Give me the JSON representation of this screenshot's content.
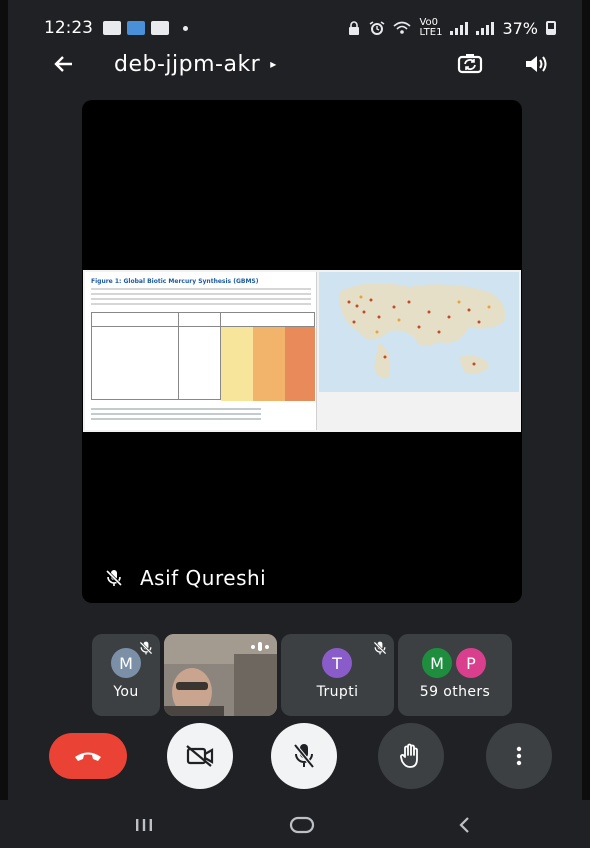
{
  "status_bar": {
    "time": "12:23",
    "battery": "37%",
    "network_label_top": "Vo0",
    "network_label_bottom": "LTE1"
  },
  "header": {
    "meeting_code": "deb-jjpm-akr",
    "caret": "▸"
  },
  "main": {
    "presenter_name": "Asif Qureshi",
    "slide_title": "Figure 1: Global Biotic Mercury Synthesis (GBMS)"
  },
  "participants": [
    {
      "initial": "M",
      "label": "You",
      "avatar_color": "#7b8fa6",
      "muted": true
    },
    {
      "label": "",
      "video": true,
      "speaking": true
    },
    {
      "initial": "T",
      "label": "Trupti",
      "avatar_color": "#8a5cc9",
      "muted": true
    },
    {
      "initials": [
        "M",
        "P"
      ],
      "label": "59 others",
      "avatar_colors": [
        "#1e8e3e",
        "#d93f8c"
      ]
    }
  ],
  "colors": {
    "end_call": "#ea4335",
    "background": "#202124",
    "tile": "#3c4043"
  }
}
